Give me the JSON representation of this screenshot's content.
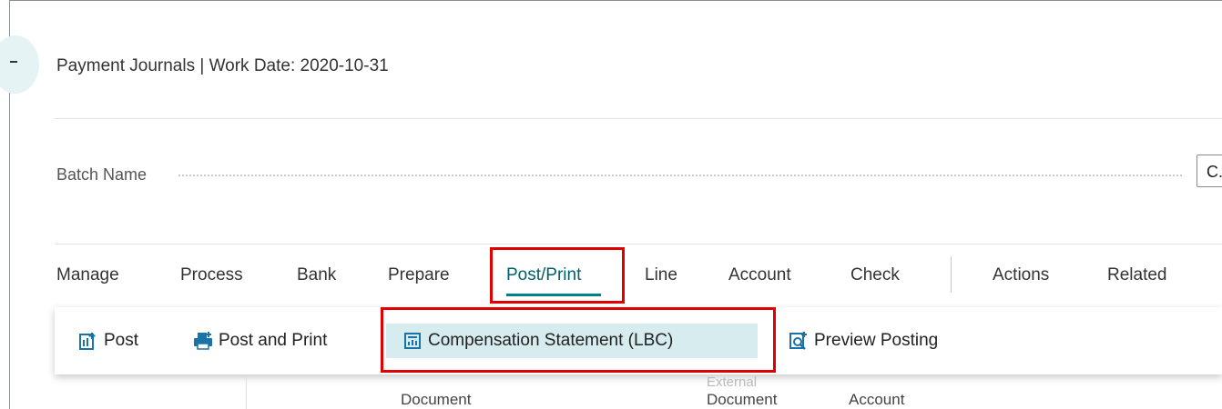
{
  "header": {
    "title": "Payment Journals | Work Date: 2020-10-31"
  },
  "batch": {
    "label": "Batch Name",
    "value": "C..."
  },
  "tabs": [
    {
      "label": "Manage"
    },
    {
      "label": "Process"
    },
    {
      "label": "Bank"
    },
    {
      "label": "Prepare"
    },
    {
      "label": "Post/Print",
      "active": true
    },
    {
      "label": "Line"
    },
    {
      "label": "Account"
    },
    {
      "label": "Check"
    },
    {
      "label": "Actions"
    },
    {
      "label": "Related"
    }
  ],
  "actions": [
    {
      "label": "Post",
      "icon": "post-icon"
    },
    {
      "label": "Post and Print",
      "icon": "printer-icon"
    },
    {
      "label": "Compensation Statement (LBC)",
      "icon": "report-icon",
      "selected": true
    },
    {
      "label": "Preview Posting",
      "icon": "preview-icon"
    }
  ],
  "columns": {
    "document": "Document",
    "external_partial": "External",
    "external_document": "Document",
    "account": "Account"
  },
  "colors": {
    "accent": "#00808a",
    "highlight": "#e00000",
    "selected_bg": "#d7ecef"
  }
}
